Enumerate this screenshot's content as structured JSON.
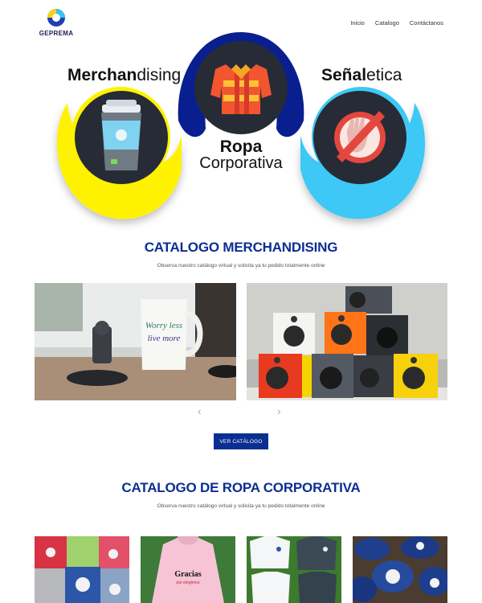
{
  "brand": {
    "name": "GEPREMA"
  },
  "nav": {
    "items": [
      "Inicio",
      "Catalogo",
      "Contáctanos"
    ]
  },
  "hero": {
    "merch_bold": "Merchan",
    "merch_rest": "dising",
    "senal_bold": "Señal",
    "senal_rest": "etica",
    "ropa_line1": "Ropa",
    "ropa_line2": "Corporativa"
  },
  "merch_section": {
    "title": "CATALOGO MERCHANDISING",
    "subtitle": "Observa nuestro catálogo virtual y solicita ya tu pedido totalmente online",
    "button": "VER CATÁLOGO",
    "prev": "‹",
    "next": "›"
  },
  "ropa_section": {
    "title": "CATALOGO DE ROPA CORPORATIVA",
    "subtitle": "Observa nuestro catálogo virtual y solicita ya tu pedido totalmente online"
  },
  "colors": {
    "primary": "#0b2e93",
    "yellow": "#fff200",
    "navy": "#0a1f8f",
    "sky": "#3ec8f5"
  }
}
